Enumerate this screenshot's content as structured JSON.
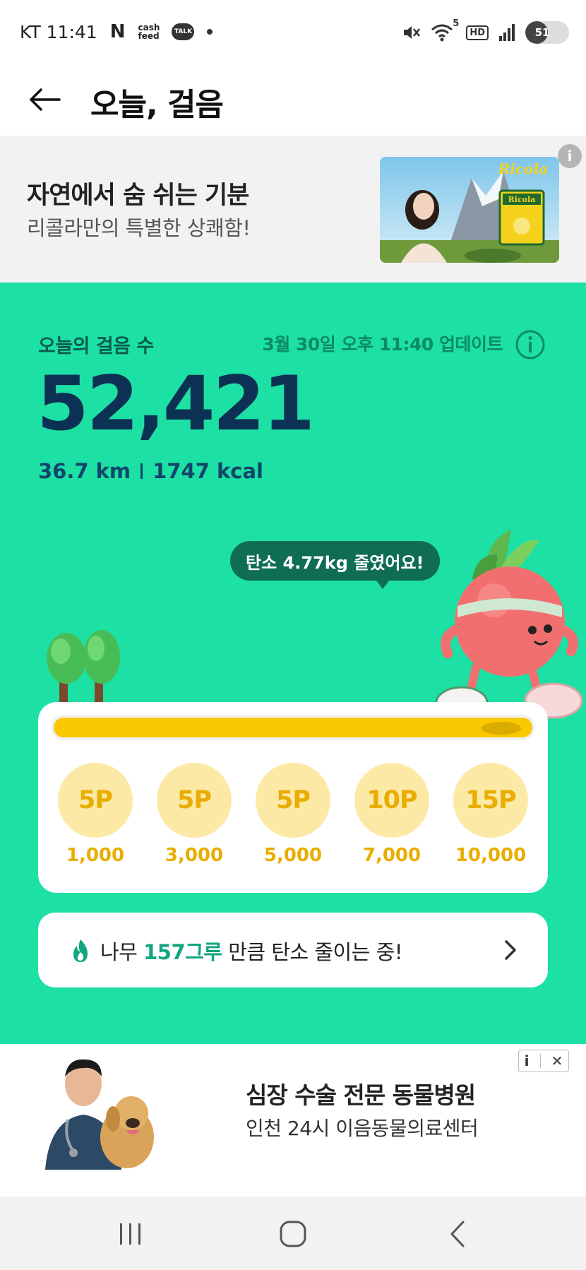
{
  "status_bar": {
    "carrier_time": "KT 11:41",
    "n_icon": "N",
    "cash_label": "cash feed",
    "talk_label": "TALK",
    "network_label": "5",
    "hd_label": "HD",
    "battery_level": "51"
  },
  "header": {
    "title": "오늘, 걸음"
  },
  "top_ad": {
    "title": "자연에서 숨 쉬는 기분",
    "subtitle": "리콜라만의 특별한 상쾌함!",
    "brand": "Ricola",
    "info_icon": "i"
  },
  "steps": {
    "label": "오늘의 걸음 수",
    "update_text": "3월 30일 오후 11:40 업데이트",
    "count": "52,421",
    "distance": "36.7 km",
    "calories": "1747 kcal"
  },
  "speech_bubble": {
    "text": "탄소 4.77kg 줄였어요!"
  },
  "progress": {
    "fraction": 1.0
  },
  "milestones": [
    {
      "points": "5P",
      "steps": "1,000"
    },
    {
      "points": "5P",
      "steps": "3,000"
    },
    {
      "points": "5P",
      "steps": "5,000"
    },
    {
      "points": "10P",
      "steps": "7,000"
    },
    {
      "points": "15P",
      "steps": "10,000"
    }
  ],
  "tree_banner": {
    "prefix": "나무 ",
    "highlight": "157그루",
    "suffix": " 만큼 탄소 줄이는 중!"
  },
  "bottom_ad": {
    "title": "심장 수술 전문 동물병원",
    "subtitle": "인천 24시 이음동물의료센터",
    "info_label": "i",
    "close_label": "✕"
  },
  "colors": {
    "main_green": "#1de0a4",
    "dark_navy": "#0d3154",
    "progress_yellow": "#f9c800",
    "milestone_bg": "#fde9a6",
    "milestone_text": "#e8ad00",
    "highlight_green": "#11a67e"
  }
}
